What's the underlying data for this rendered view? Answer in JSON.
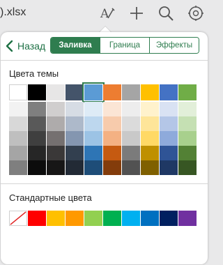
{
  "toolbar": {
    "filename": ").xlsx",
    "icons": [
      "format-icon",
      "add-icon",
      "search-icon",
      "settings-icon"
    ]
  },
  "nav": {
    "back_label": "Назад",
    "tabs": [
      {
        "label": "Заливка",
        "active": true
      },
      {
        "label": "Граница",
        "active": false
      },
      {
        "label": "Эффекты",
        "active": false
      }
    ]
  },
  "theme": {
    "title": "Цвета темы",
    "selected": {
      "row": 0,
      "col": 4
    },
    "rows": [
      [
        "#ffffff",
        "#000000",
        "#e7e6e6",
        "#44546a",
        "#5b9bd5",
        "#ed7d31",
        "#a5a5a5",
        "#ffc000",
        "#4472c4",
        "#70ad47"
      ],
      [
        "#f2f2f2",
        "#7f7f7f",
        "#d0cece",
        "#d6dce4",
        "#deebf6",
        "#fbe5d5",
        "#ededed",
        "#fff2cc",
        "#d9e2f3",
        "#e2efd9"
      ],
      [
        "#d8d8d8",
        "#595959",
        "#aeabab",
        "#adb9ca",
        "#bdd7ee",
        "#f7cbac",
        "#dbdbdb",
        "#fee599",
        "#b4c6e7",
        "#c5e0b3"
      ],
      [
        "#bfbfbf",
        "#3f3f3f",
        "#757070",
        "#8496b0",
        "#9cc3e5",
        "#f4b183",
        "#c9c9c9",
        "#ffd965",
        "#8eaadb",
        "#a8d08d"
      ],
      [
        "#a5a5a5",
        "#262626",
        "#3a3838",
        "#323f4f",
        "#2e75b5",
        "#c55a11",
        "#7b7b7b",
        "#bf9000",
        "#2f5496",
        "#538135"
      ],
      [
        "#7f7f7f",
        "#0c0c0c",
        "#171616",
        "#222a35",
        "#1e4d78",
        "#833c0b",
        "#525252",
        "#7f6000",
        "#1f3864",
        "#375623"
      ]
    ]
  },
  "standard": {
    "title": "Стандартные цвета",
    "colors": [
      "none",
      "#ff0000",
      "#ffc000",
      "#ff9900",
      "#92d050",
      "#00b050",
      "#00b0f0",
      "#0070c0",
      "#002060",
      "#7030a0"
    ]
  }
}
